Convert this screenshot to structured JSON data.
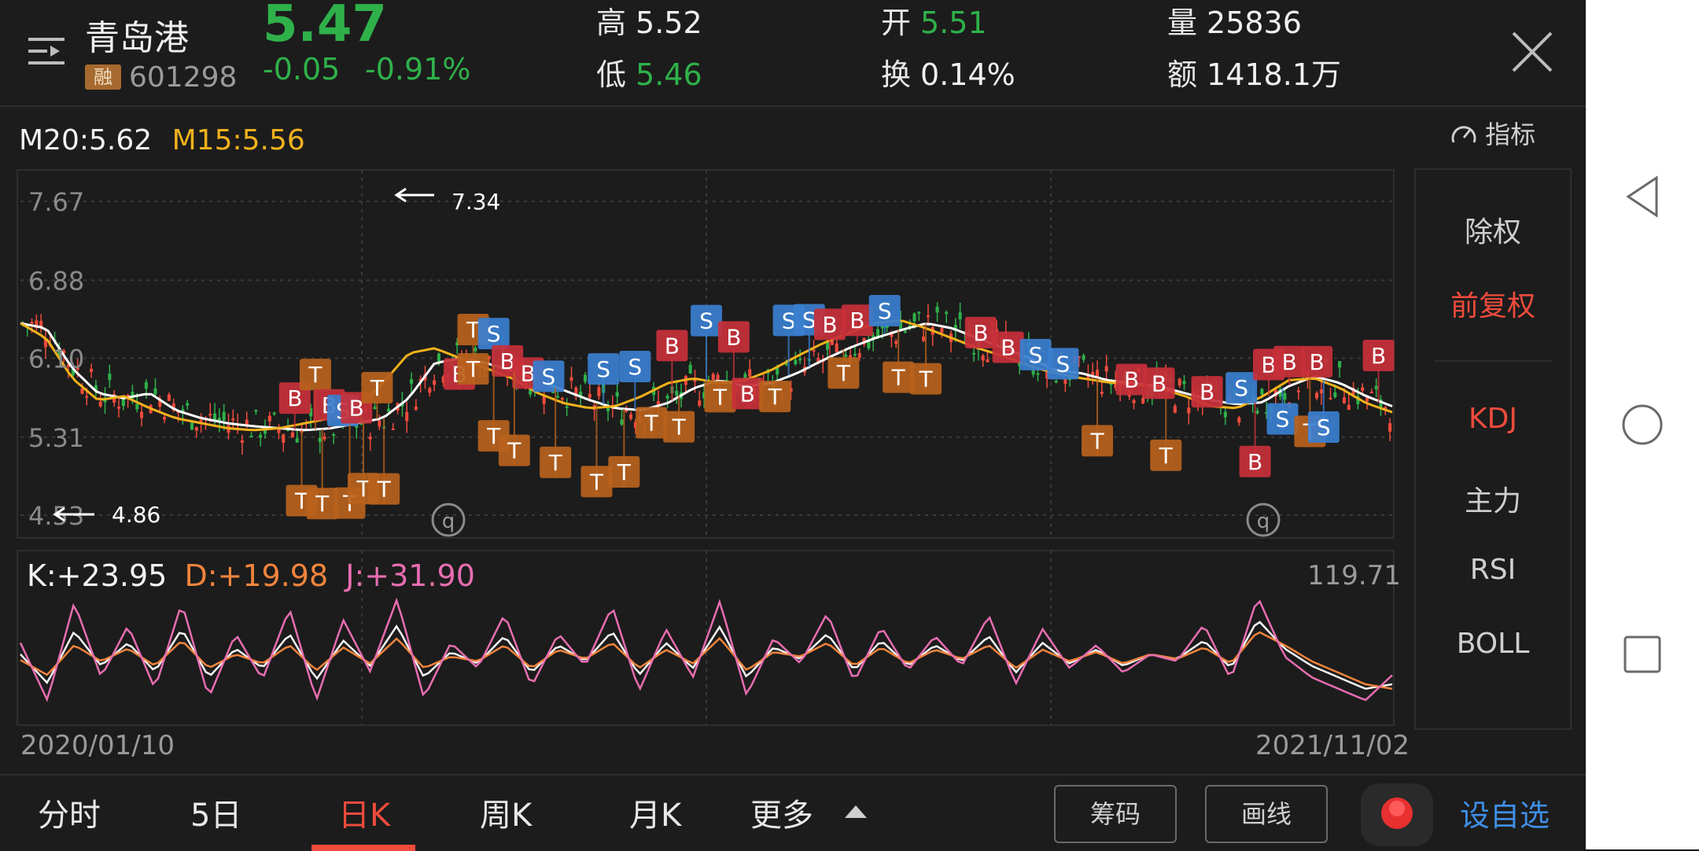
{
  "header": {
    "stock_name": "青岛港",
    "margin_badge": "融",
    "stock_code": "601298",
    "price": "5.47",
    "change": "-0.05",
    "change_pct": "-0.91%",
    "quotes": {
      "high_label": "高",
      "high_value": "5.52",
      "low_label": "低",
      "low_value": "5.46",
      "open_label": "开",
      "open_value": "5.51",
      "turnover_label": "换",
      "turnover_value": "0.14%",
      "volume_label": "量",
      "volume_value": "25836",
      "amount_label": "额",
      "amount_value": "1418.1万"
    }
  },
  "ma_legend": {
    "m20": "M20:5.62",
    "m15": "M15:5.56"
  },
  "indicator_button": "指标",
  "price_axis": {
    "labels": [
      "7.67",
      "6.88",
      "6.10",
      "5.31",
      "4.53"
    ]
  },
  "annotations": {
    "high": "7.34",
    "low": "4.86",
    "event_marker": "q"
  },
  "kdj": {
    "k": "K:+23.95",
    "d": "D:+19.98",
    "j": "J:+31.90",
    "max": "119.71"
  },
  "date_range": {
    "start": "2020/01/10",
    "end": "2021/11/02"
  },
  "side_panel": {
    "items": [
      {
        "label": "除权",
        "active": false
      },
      {
        "label": "前复权",
        "active": true
      },
      {
        "label": "KDJ",
        "active": true
      },
      {
        "label": "主力",
        "active": false
      },
      {
        "label": "RSI",
        "active": false
      },
      {
        "label": "BOLL",
        "active": false
      }
    ]
  },
  "bottom_tabs": {
    "minute": "分时",
    "five_day": "5日",
    "daily": "日K",
    "weekly": "周K",
    "monthly": "月K",
    "more": "更多"
  },
  "tools": {
    "chips": "筹码",
    "draw": "画线"
  },
  "add_watchlist": "设自选",
  "colors": {
    "up": "#ef4b3c",
    "down": "#2fb14a",
    "ma20": "#ffffff",
    "ma15": "#f2b21c",
    "buy": "#c8303a",
    "sell": "#3a7fd0",
    "t": "#b8621c"
  },
  "chart_data": [
    {
      "type": "line",
      "title": "",
      "x_range": [
        "2020/01/10",
        "2021/11/02"
      ],
      "ylim": [
        4.53,
        7.67
      ],
      "yticks": [
        7.67,
        6.88,
        6.1,
        5.31,
        4.53
      ],
      "series": [
        {
          "name": "M20",
          "values": [
            6.45,
            6.4,
            6.0,
            5.75,
            5.7,
            5.75,
            5.58,
            5.5,
            5.45,
            5.42,
            5.4,
            5.38,
            5.4,
            5.45,
            5.5,
            5.7,
            6.05,
            6.1,
            6.05,
            5.98,
            5.88,
            5.78,
            5.68,
            5.6,
            5.58,
            5.65,
            5.8,
            5.88,
            5.82,
            5.85,
            5.95,
            6.08,
            6.2,
            6.3,
            6.38,
            6.45,
            6.4,
            6.3,
            6.2,
            6.1,
            5.98,
            5.95,
            5.88,
            5.85,
            5.82,
            5.75,
            5.68,
            5.64,
            5.66,
            5.82,
            5.92,
            5.85,
            5.72,
            5.62
          ]
        },
        {
          "name": "M15",
          "values": [
            6.45,
            6.3,
            5.9,
            5.68,
            5.72,
            5.6,
            5.5,
            5.45,
            5.4,
            5.38,
            5.4,
            5.45,
            5.5,
            5.6,
            5.85,
            6.15,
            6.2,
            6.1,
            6.0,
            5.9,
            5.75,
            5.65,
            5.6,
            5.62,
            5.72,
            5.85,
            5.9,
            5.85,
            5.88,
            5.98,
            6.12,
            6.25,
            6.35,
            6.45,
            6.48,
            6.4,
            6.3,
            6.2,
            6.12,
            6.02,
            5.95,
            5.9,
            5.86,
            5.84,
            5.8,
            5.72,
            5.62,
            5.6,
            5.72,
            5.88,
            5.9,
            5.8,
            5.65,
            5.56
          ]
        }
      ]
    },
    {
      "type": "line",
      "title": "",
      "ymax": 119.71,
      "series": [
        {
          "name": "K",
          "values": [
            50,
            25,
            70,
            40,
            60,
            35,
            72,
            30,
            55,
            38,
            68,
            28,
            62,
            40,
            75,
            30,
            52,
            42,
            66,
            34,
            58,
            44,
            70,
            32,
            60,
            38,
            74,
            30,
            56,
            46,
            68,
            36,
            62,
            40,
            58,
            44,
            66,
            34,
            60,
            42,
            54,
            40,
            50,
            46,
            62,
            38,
            80,
            55,
            40,
            30,
            20,
            23.95
          ]
        },
        {
          "name": "D",
          "values": [
            45,
            32,
            58,
            44,
            55,
            40,
            62,
            38,
            50,
            42,
            58,
            36,
            56,
            42,
            64,
            38,
            48,
            44,
            58,
            38,
            54,
            46,
            60,
            38,
            54,
            42,
            64,
            36,
            52,
            48,
            60,
            40,
            56,
            42,
            54,
            46,
            58,
            38,
            54,
            44,
            52,
            42,
            50,
            46,
            56,
            42,
            70,
            58,
            44,
            34,
            24,
            19.98
          ]
        },
        {
          "name": "J",
          "values": [
            60,
            10,
            95,
            30,
            75,
            20,
            95,
            12,
            68,
            28,
            90,
            10,
            80,
            35,
            98,
            12,
            60,
            38,
            85,
            22,
            68,
            40,
            92,
            18,
            72,
            30,
            96,
            14,
            64,
            42,
            86,
            26,
            74,
            36,
            66,
            40,
            84,
            24,
            72,
            38,
            58,
            34,
            50,
            44,
            76,
            28,
            100,
            48,
            30,
            20,
            10,
            31.9
          ]
        }
      ]
    }
  ]
}
